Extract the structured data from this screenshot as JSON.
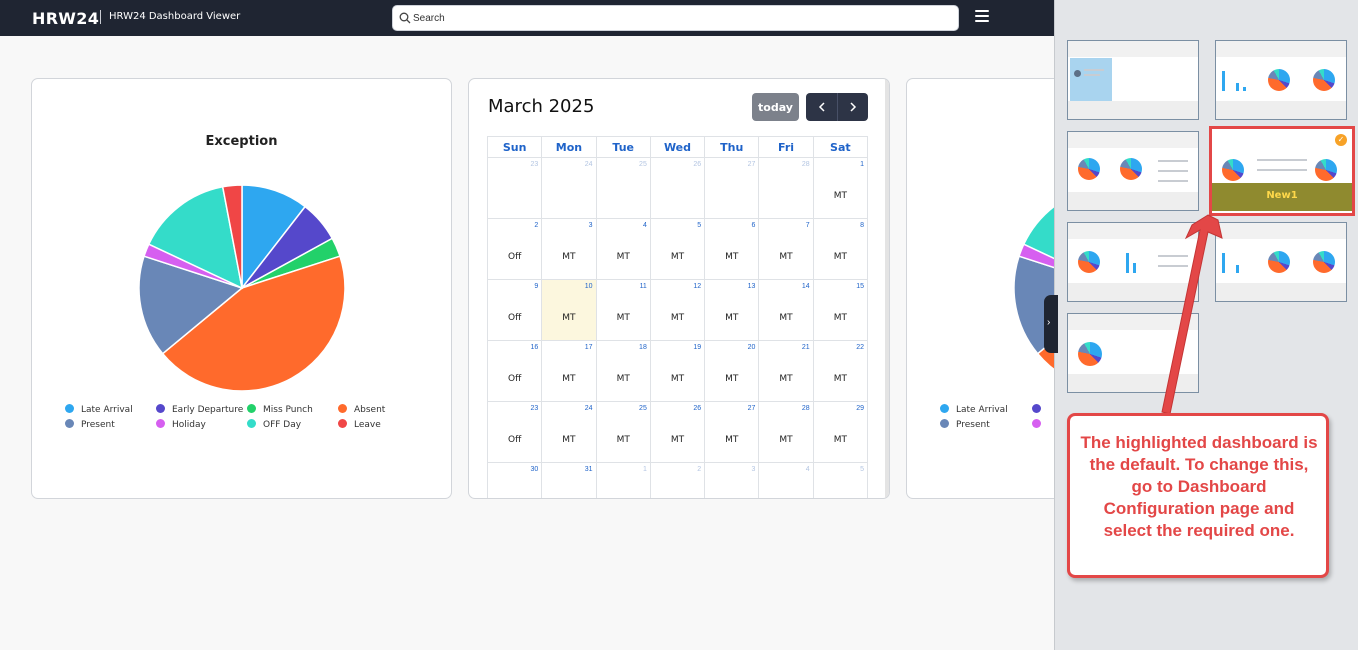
{
  "header": {
    "brand": "HRW24",
    "subtitle": "HRW24 Dashboard Viewer",
    "search_placeholder": "Search"
  },
  "exception_chart": {
    "chart_data": {
      "type": "pie",
      "title": "Exception",
      "series": [
        {
          "name": "Late Arrival",
          "value": 10.5,
          "color": "#2ea7f0"
        },
        {
          "name": "Early Departure",
          "value": 6.5,
          "color": "#5548cb"
        },
        {
          "name": "Miss Punch",
          "value": 3,
          "color": "#22d16a"
        },
        {
          "name": "Absent",
          "value": 44,
          "color": "#ff6a2c"
        },
        {
          "name": "Present",
          "value": 16,
          "color": "#6987b7"
        },
        {
          "name": "Holiday",
          "value": 2,
          "color": "#d65ff0"
        },
        {
          "name": "OFF Day",
          "value": 15,
          "color": "#34dcc9"
        },
        {
          "name": "Leave",
          "value": 3,
          "color": "#f04646"
        }
      ],
      "legend_position": "bottom"
    }
  },
  "calendar": {
    "title": "March 2025",
    "today_label": "today",
    "weekdays": [
      "Sun",
      "Mon",
      "Tue",
      "Wed",
      "Thu",
      "Fri",
      "Sat"
    ],
    "weeks": [
      [
        {
          "d": "23",
          "o": true,
          "e": ""
        },
        {
          "d": "24",
          "o": true,
          "e": ""
        },
        {
          "d": "25",
          "o": true,
          "e": ""
        },
        {
          "d": "26",
          "o": true,
          "e": ""
        },
        {
          "d": "27",
          "o": true,
          "e": ""
        },
        {
          "d": "28",
          "o": true,
          "e": ""
        },
        {
          "d": "1",
          "o": false,
          "e": "MT"
        }
      ],
      [
        {
          "d": "2",
          "o": false,
          "e": "Off"
        },
        {
          "d": "3",
          "o": false,
          "e": "MT"
        },
        {
          "d": "4",
          "o": false,
          "e": "MT"
        },
        {
          "d": "5",
          "o": false,
          "e": "MT"
        },
        {
          "d": "6",
          "o": false,
          "e": "MT"
        },
        {
          "d": "7",
          "o": false,
          "e": "MT"
        },
        {
          "d": "8",
          "o": false,
          "e": "MT"
        }
      ],
      [
        {
          "d": "9",
          "o": false,
          "e": "Off"
        },
        {
          "d": "10",
          "o": false,
          "e": "MT",
          "t": true
        },
        {
          "d": "11",
          "o": false,
          "e": "MT"
        },
        {
          "d": "12",
          "o": false,
          "e": "MT"
        },
        {
          "d": "13",
          "o": false,
          "e": "MT"
        },
        {
          "d": "14",
          "o": false,
          "e": "MT"
        },
        {
          "d": "15",
          "o": false,
          "e": "MT"
        }
      ],
      [
        {
          "d": "16",
          "o": false,
          "e": "Off"
        },
        {
          "d": "17",
          "o": false,
          "e": "MT"
        },
        {
          "d": "18",
          "o": false,
          "e": "MT"
        },
        {
          "d": "19",
          "o": false,
          "e": "MT"
        },
        {
          "d": "20",
          "o": false,
          "e": "MT"
        },
        {
          "d": "21",
          "o": false,
          "e": "MT"
        },
        {
          "d": "22",
          "o": false,
          "e": "MT"
        }
      ],
      [
        {
          "d": "23",
          "o": false,
          "e": "Off"
        },
        {
          "d": "24",
          "o": false,
          "e": "MT"
        },
        {
          "d": "25",
          "o": false,
          "e": "MT"
        },
        {
          "d": "26",
          "o": false,
          "e": "MT"
        },
        {
          "d": "27",
          "o": false,
          "e": "MT"
        },
        {
          "d": "28",
          "o": false,
          "e": "MT"
        },
        {
          "d": "29",
          "o": false,
          "e": "MT"
        }
      ],
      [
        {
          "d": "30",
          "o": false,
          "e": ""
        },
        {
          "d": "31",
          "o": false,
          "e": ""
        },
        {
          "d": "1",
          "o": true,
          "e": ""
        },
        {
          "d": "2",
          "o": true,
          "e": ""
        },
        {
          "d": "3",
          "o": true,
          "e": ""
        },
        {
          "d": "4",
          "o": true,
          "e": ""
        },
        {
          "d": "5",
          "o": true,
          "e": ""
        }
      ]
    ]
  },
  "right_card": {
    "legend": [
      "Late Arrival",
      "Present"
    ]
  },
  "panel": {
    "selected_label": "New1",
    "callout_text": "The highlighted dashboard is the default. To change this, go to Dashboard Configuration page and select the required one."
  }
}
